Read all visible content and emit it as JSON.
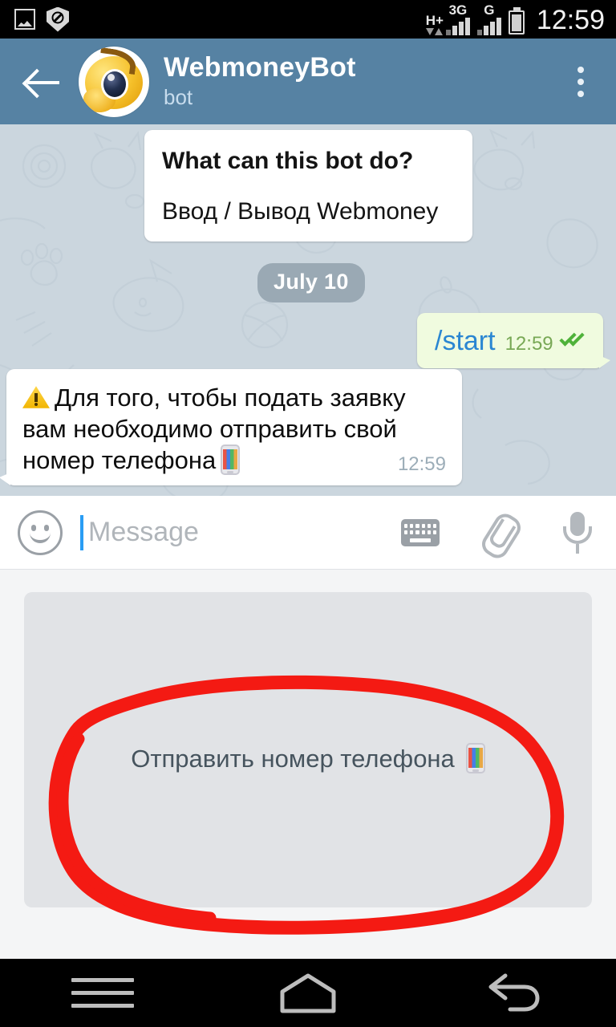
{
  "status_bar": {
    "time": "12:59",
    "icons": [
      "image-icon",
      "shield-block-icon"
    ],
    "network_primary": "H+",
    "network_primary_type": "3G",
    "network_secondary": "G",
    "battery": "battery-icon"
  },
  "header": {
    "back_label": "back-arrow",
    "title": "WebmoneyBot",
    "subtitle": "bot",
    "avatar_alt": "webmoney-winky-avatar",
    "menu_label": "overflow-menu"
  },
  "chat": {
    "info_bubble": {
      "question": "What can this bot do?",
      "answer": "Ввод / Вывод Webmoney"
    },
    "date_divider": "July 10",
    "outgoing": {
      "text": "/start",
      "time": "12:59",
      "status": "read-double-check"
    },
    "incoming": {
      "emoji_leading": "warning-emoji",
      "text": "Для того, чтобы подать заявку вам необходимо отправить свой номер телефона",
      "emoji_trailing": "mobile-phone-emoji",
      "time": "12:59"
    }
  },
  "input_bar": {
    "emoji_button": "smiley-icon",
    "placeholder": "Message",
    "value": "",
    "keyboard_button": "keyboard-icon",
    "attach_button": "paperclip-icon",
    "voice_button": "microphone-icon"
  },
  "keyboard_panel": {
    "button_label": "Отправить номер телефона",
    "button_emoji": "mobile-phone-emoji",
    "annotation": "red-hand-drawn-ellipse",
    "annotation_color": "#f41a13"
  },
  "nav_bar": {
    "menu": "menu-icon",
    "home": "home-icon",
    "back": "back-icon"
  },
  "colors": {
    "header": "#5682a3",
    "chat_bg": "#cbd6de",
    "outgoing_bubble": "#f0fbdf",
    "incoming_bubble": "#ffffff",
    "accent_link": "#2a86d2",
    "annotation_red": "#f41a13",
    "panel_bg": "#e1e3e6"
  }
}
